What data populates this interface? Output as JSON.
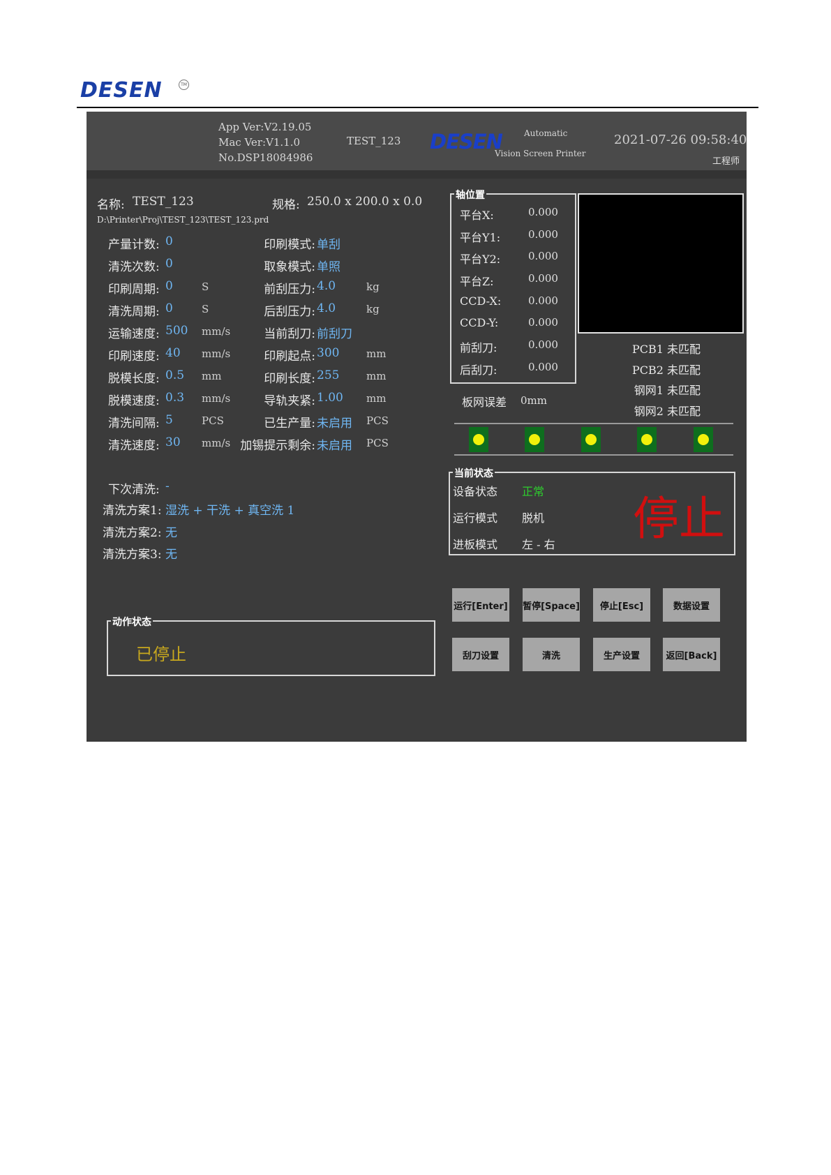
{
  "doc_header": {
    "logo_text": "DESEN",
    "tm_mark": "TM"
  },
  "header": {
    "app_ver": "App Ver:V2.19.05",
    "mac_ver": "Mac Ver:V1.1.0",
    "serial": "No.DSP18084986",
    "project": "TEST_123",
    "logo_text": "DESEN",
    "product_line1": "Automatic",
    "product_line2": "Vision Screen Printer",
    "datetime": "2021-07-26 09:58:40",
    "user_role": "工程师"
  },
  "product": {
    "name_label": "名称:",
    "name_value": "TEST_123",
    "spec_label": "规格:",
    "spec_value": "250.0 x 200.0 x 0.0",
    "path": "D:\\Printer\\Proj\\TEST_123\\TEST_123.prd"
  },
  "params_left": [
    {
      "label": "产量计数:",
      "value": "0",
      "unit": ""
    },
    {
      "label": "清洗次数:",
      "value": "0",
      "unit": ""
    },
    {
      "label": "印刷周期:",
      "value": "0",
      "unit": "S"
    },
    {
      "label": "清洗周期:",
      "value": "0",
      "unit": "S"
    },
    {
      "label": "运输速度:",
      "value": "500",
      "unit": "mm/s"
    },
    {
      "label": "印刷速度:",
      "value": "40",
      "unit": "mm/s"
    },
    {
      "label": "脱模长度:",
      "value": "0.5",
      "unit": "mm"
    },
    {
      "label": "脱模速度:",
      "value": "0.3",
      "unit": "mm/s"
    },
    {
      "label": "清洗间隔:",
      "value": "5",
      "unit": "PCS"
    },
    {
      "label": "清洗速度:",
      "value": "30",
      "unit": "mm/s"
    }
  ],
  "params_right": [
    {
      "label": "印刷模式:",
      "value": "单刮",
      "unit": ""
    },
    {
      "label": "取象模式:",
      "value": "单照",
      "unit": ""
    },
    {
      "label": "前刮压力:",
      "value": "4.0",
      "unit": "kg"
    },
    {
      "label": "后刮压力:",
      "value": "4.0",
      "unit": "kg"
    },
    {
      "label": "当前刮刀:",
      "value": "前刮刀",
      "unit": ""
    },
    {
      "label": "印刷起点:",
      "value": "300",
      "unit": "mm"
    },
    {
      "label": "印刷长度:",
      "value": "255",
      "unit": "mm"
    },
    {
      "label": "导轨夹紧:",
      "value": "1.00",
      "unit": "mm"
    },
    {
      "label": "已生产量:",
      "value": "未启用",
      "unit": "PCS"
    },
    {
      "label": "加锡提示剩余:",
      "value": "未启用",
      "unit": "PCS"
    }
  ],
  "cleaning": {
    "next_label": "下次清洗:",
    "next_value": "-",
    "plan1_label": "清洗方案1:",
    "plan1_value": "湿洗 + 干洗 + 真空洗  1",
    "plan2_label": "清洗方案2:",
    "plan2_value": "无",
    "plan3_label": "清洗方案3:",
    "plan3_value": "无"
  },
  "action_status": {
    "title": "动作状态",
    "value": "已停止"
  },
  "axis_position": {
    "title": "轴位置",
    "rows": [
      {
        "label": "平台X:",
        "value": "0.000"
      },
      {
        "label": "平台Y1:",
        "value": "0.000"
      },
      {
        "label": "平台Y2:",
        "value": "0.000"
      },
      {
        "label": "平台Z:",
        "value": "0.000"
      },
      {
        "label": "CCD-X:",
        "value": "0.000"
      },
      {
        "label": "CCD-Y:",
        "value": "0.000"
      },
      {
        "label": "前刮刀:",
        "value": "0.000"
      },
      {
        "label": "后刮刀:",
        "value": "0.000"
      }
    ]
  },
  "match": [
    {
      "label": "PCB1",
      "value": "未匹配"
    },
    {
      "label": "PCB2",
      "value": "未匹配"
    },
    {
      "label": "钢网1",
      "value": "未匹配"
    },
    {
      "label": "钢网2",
      "value": "未匹配"
    }
  ],
  "offset": {
    "label": "板网误差",
    "value": "0mm"
  },
  "indicators": {
    "count": 5,
    "led_color": "#f1f10b",
    "cell_color": "#0e6e1e"
  },
  "current_status": {
    "title": "当前状态",
    "device_label": "设备状态",
    "device_value": "正常",
    "run_label": "运行模式",
    "run_value": "脱机",
    "feed_label": "进板模式",
    "feed_value": "左 - 右",
    "big_status": "停止"
  },
  "buttons": {
    "run": "运行[Enter]",
    "pause": "暂停[Space]",
    "stop": "停止[Esc]",
    "data": "数据设置",
    "squeegee": "刮刀设置",
    "clean": "清洗",
    "production": "生产设置",
    "back": "返回[Back]"
  },
  "colors": {
    "screen_bg": "#3b3b3b",
    "value_blue": "#6fb6f2",
    "ok_green": "#2ecc2e",
    "stop_red": "#d10f0f",
    "action_yellow": "#c8a81e"
  }
}
